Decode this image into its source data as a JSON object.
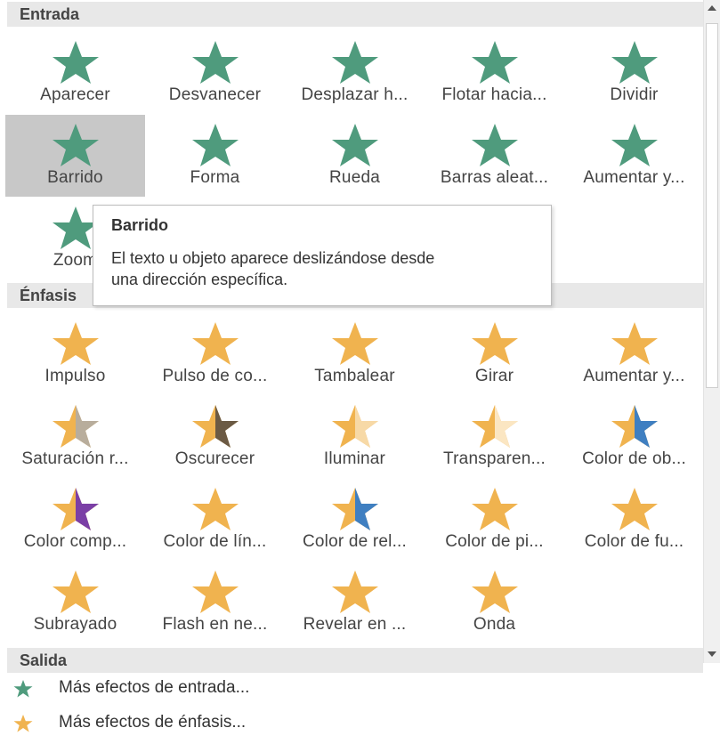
{
  "sections": {
    "entrada": "Entrada",
    "enfasis": "Énfasis",
    "salida": "Salida"
  },
  "entrada_effects": [
    {
      "label": "Aparecer",
      "icon": "appear-star-icon"
    },
    {
      "label": "Desvanecer",
      "icon": "fade-star-icon"
    },
    {
      "label": "Desplazar h...",
      "icon": "fly-in-star-icon"
    },
    {
      "label": "Flotar hacia...",
      "icon": "float-in-star-icon"
    },
    {
      "label": "Dividir",
      "icon": "split-star-icon"
    },
    {
      "label": "Barrido",
      "icon": "wipe-star-icon",
      "selected": true
    },
    {
      "label": "Forma",
      "icon": "shape-star-icon"
    },
    {
      "label": "Rueda",
      "icon": "wheel-star-icon"
    },
    {
      "label": "Barras aleat...",
      "icon": "random-bars-star-icon"
    },
    {
      "label": "Aumentar y...",
      "icon": "grow-turn-star-icon"
    },
    {
      "label": "Zoom",
      "icon": "zoom-star-icon"
    }
  ],
  "enfasis_effects": [
    {
      "label": "Impulso",
      "icon": "pulse-star-icon"
    },
    {
      "label": "Pulso de co...",
      "icon": "color-pulse-star-icon"
    },
    {
      "label": "Tambalear",
      "icon": "teeter-star-icon"
    },
    {
      "label": "Girar",
      "icon": "spin-star-icon"
    },
    {
      "label": "Aumentar y...",
      "icon": "grow-shrink-star-icon"
    },
    {
      "label": "Saturación r...",
      "icon": "desaturate-star-icon"
    },
    {
      "label": "Oscurecer",
      "icon": "darken-star-icon"
    },
    {
      "label": "Iluminar",
      "icon": "lighten-star-icon"
    },
    {
      "label": "Transparen...",
      "icon": "transparency-star-icon"
    },
    {
      "label": "Color de ob...",
      "icon": "object-color-star-icon"
    },
    {
      "label": "Color comp...",
      "icon": "complementary-color-star-icon"
    },
    {
      "label": "Color de lín...",
      "icon": "line-color-star-icon"
    },
    {
      "label": "Color de rel...",
      "icon": "fill-color-star-icon"
    },
    {
      "label": "Color de pi...",
      "icon": "brush-color-star-icon"
    },
    {
      "label": "Color de fu...",
      "icon": "font-color-star-icon"
    },
    {
      "label": "Subrayado",
      "icon": "underline-star-icon"
    },
    {
      "label": "Flash en ne...",
      "icon": "bold-flash-star-icon"
    },
    {
      "label": "Revelar en ...",
      "icon": "bold-reveal-star-icon"
    },
    {
      "label": "Onda",
      "icon": "wave-star-icon"
    }
  ],
  "tooltip": {
    "title": "Barrido",
    "line1": "El texto u objeto aparece deslizándose desde",
    "line2": "una dirección específica."
  },
  "more_links": {
    "entrada": "Más efectos de entrada...",
    "enfasis": "Más efectos de énfasis..."
  },
  "colors": {
    "entrance_green": "#4f9b7d",
    "emphasis_gold": "#f0b34f",
    "selected_bg": "#c8c8c8",
    "header_bg": "#e8e8e8"
  }
}
